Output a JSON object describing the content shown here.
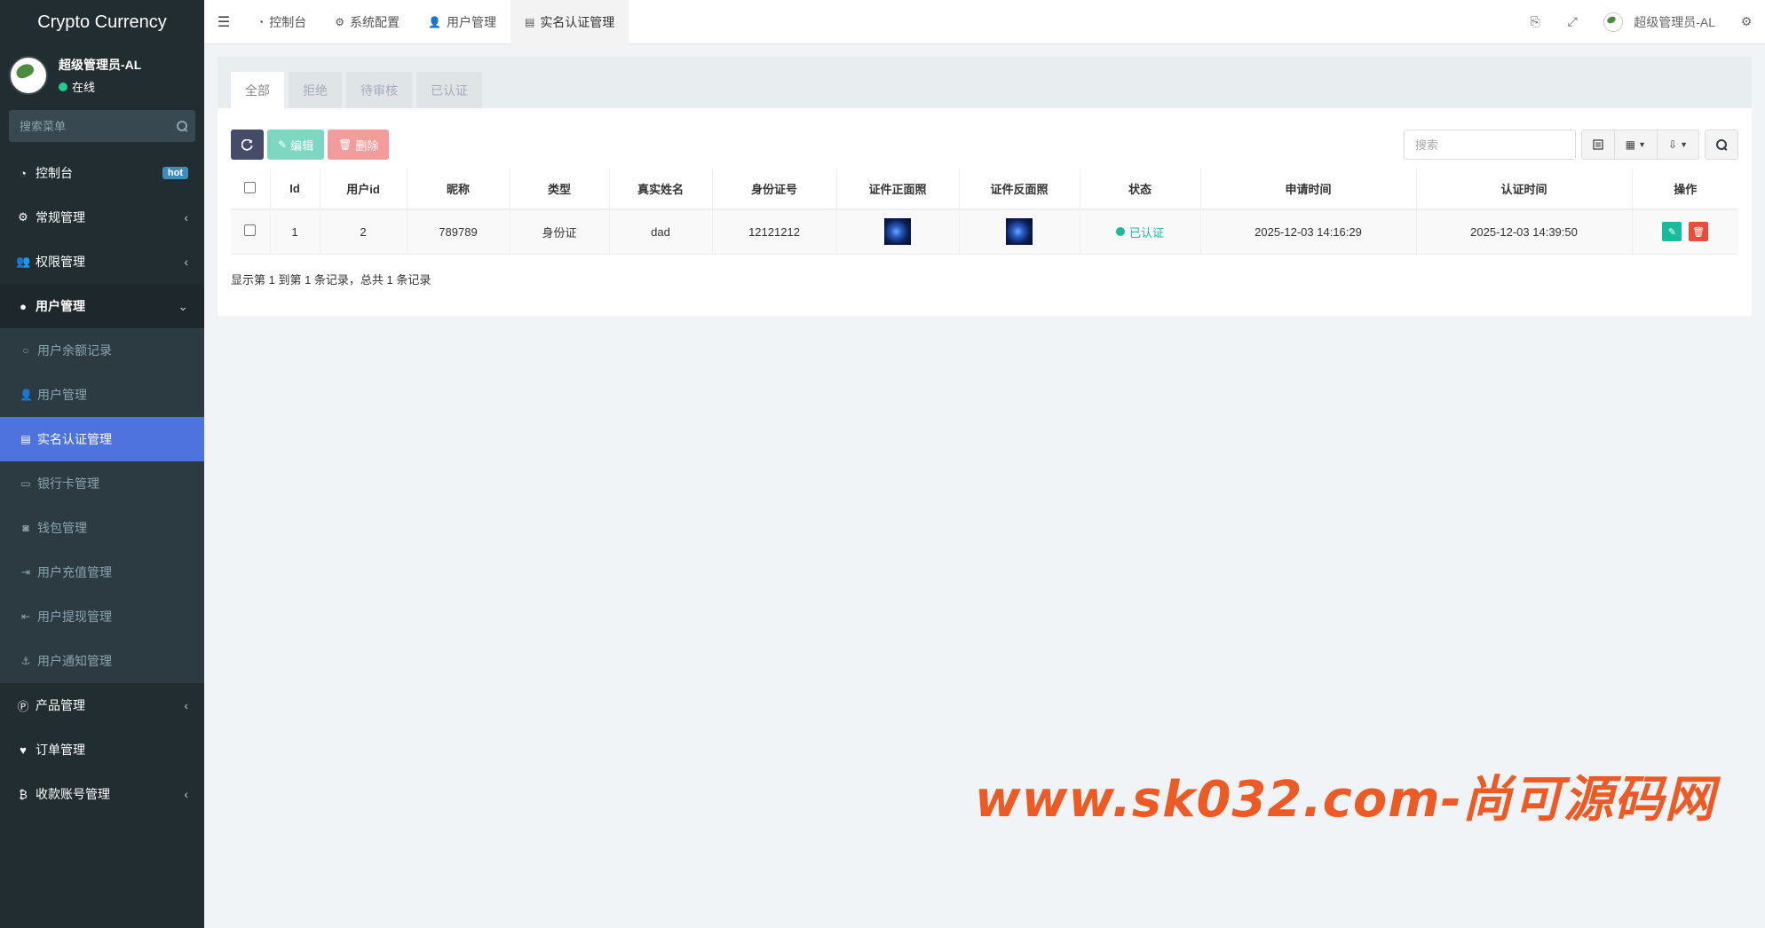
{
  "app": {
    "title": "Crypto Currency"
  },
  "user": {
    "name": "超级管理员-AL",
    "status": "在线"
  },
  "sidebar": {
    "search_placeholder": "搜索菜单",
    "items": [
      {
        "label": "控制台",
        "badge": "hot"
      },
      {
        "label": "常规管理"
      },
      {
        "label": "权限管理"
      },
      {
        "label": "用户管理"
      },
      {
        "label": "产品管理"
      },
      {
        "label": "订单管理"
      },
      {
        "label": "收款账号管理"
      }
    ],
    "submenu": [
      {
        "label": "用户余额记录"
      },
      {
        "label": "用户管理"
      },
      {
        "label": "实名认证管理"
      },
      {
        "label": "银行卡管理"
      },
      {
        "label": "钱包管理"
      },
      {
        "label": "用户充值管理"
      },
      {
        "label": "用户提现管理"
      },
      {
        "label": "用户通知管理"
      }
    ]
  },
  "topbar": {
    "tabs": [
      {
        "label": "控制台"
      },
      {
        "label": "系统配置"
      },
      {
        "label": "用户管理"
      },
      {
        "label": "实名认证管理"
      }
    ],
    "user_name": "超级管理员-AL"
  },
  "content": {
    "tabs": [
      {
        "label": "全部"
      },
      {
        "label": "拒绝"
      },
      {
        "label": "待审核"
      },
      {
        "label": "已认证"
      }
    ],
    "toolbar": {
      "edit": "编辑",
      "delete": "删除",
      "search_placeholder": "搜索"
    },
    "table": {
      "headers": [
        "Id",
        "用户id",
        "昵称",
        "类型",
        "真实姓名",
        "身份证号",
        "证件正面照",
        "证件反面照",
        "状态",
        "申请时间",
        "认证时间",
        "操作"
      ],
      "rows": [
        {
          "id": "1",
          "user_id": "2",
          "nickname": "789789",
          "type": "身份证",
          "real_name": "dad",
          "id_number": "12121212",
          "status": "已认证",
          "apply_time": "2025-12-03 14:16:29",
          "verify_time": "2025-12-03 14:39:50"
        }
      ]
    },
    "pager_text": "显示第 1 到第 1 条记录，总共 1 条记录"
  },
  "watermark": "www.sk032.com-尚可源码网",
  "colors": {
    "sidebar_bg": "#222d32",
    "active_item": "#4e73df",
    "success": "#18bc9c",
    "danger": "#e74c3c",
    "watermark": "#ee5a24"
  }
}
